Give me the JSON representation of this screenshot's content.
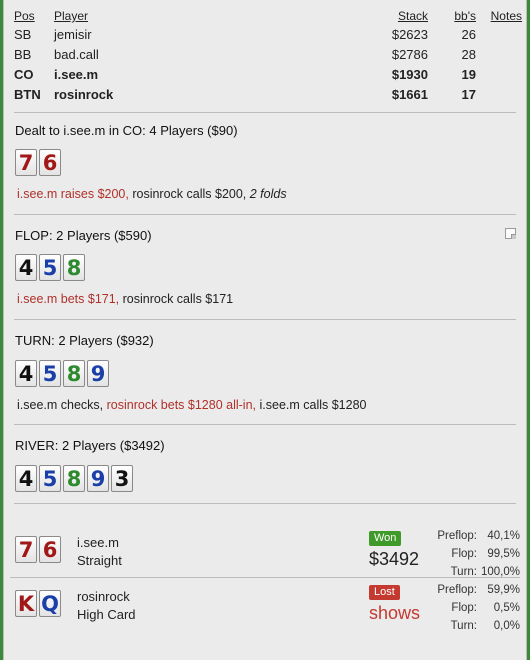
{
  "table": {
    "headers": {
      "pos": "Pos",
      "player": "Player",
      "stack": "Stack",
      "bbs": "bb's",
      "notes": "Notes"
    },
    "rows": [
      {
        "pos": "SB",
        "player": "jemisir",
        "stack": "$2623",
        "bbs": "26",
        "bold": false
      },
      {
        "pos": "BB",
        "player": "bad.call",
        "stack": "$2786",
        "bbs": "28",
        "bold": false
      },
      {
        "pos": "CO",
        "player": "i.see.m",
        "stack": "$1930",
        "bbs": "19",
        "bold": true
      },
      {
        "pos": "BTN",
        "player": "rosinrock",
        "stack": "$1661",
        "bbs": "17",
        "bold": true
      }
    ]
  },
  "preflop": {
    "title": "Dealt to i.see.m in CO: 4 Players ($90)",
    "cards": [
      {
        "rank": "7",
        "suit_color": "#a01818"
      },
      {
        "rank": "6",
        "suit_color": "#a01818"
      }
    ],
    "action_red": "i.see.m raises $200,",
    "action_plain": " rosinrock calls $200, ",
    "action_italic": "2 folds"
  },
  "flop": {
    "title": "FLOP: 2 Players ($590)",
    "cards": [
      {
        "rank": "4",
        "suit_color": "#111111"
      },
      {
        "rank": "5",
        "suit_color": "#1a3fa8"
      },
      {
        "rank": "8",
        "suit_color": "#2e8a2e"
      }
    ],
    "action_red": "i.see.m bets $171,",
    "action_plain": " rosinrock calls $171",
    "note_icon": "note-icon"
  },
  "turn": {
    "title": "TURN: 2 Players ($932)",
    "cards": [
      {
        "rank": "4",
        "suit_color": "#111111"
      },
      {
        "rank": "5",
        "suit_color": "#1a3fa8"
      },
      {
        "rank": "8",
        "suit_color": "#2e8a2e"
      },
      {
        "rank": "9",
        "suit_color": "#1a3fa8"
      }
    ],
    "action_pre": "i.see.m checks, ",
    "action_red": "rosinrock bets $1280 all-in,",
    "action_post": " i.see.m calls $1280"
  },
  "river": {
    "title": "RIVER: 2 Players ($3492)",
    "cards": [
      {
        "rank": "4",
        "suit_color": "#111111"
      },
      {
        "rank": "5",
        "suit_color": "#1a3fa8"
      },
      {
        "rank": "8",
        "suit_color": "#2e8a2e"
      },
      {
        "rank": "9",
        "suit_color": "#1a3fa8"
      },
      {
        "rank": "3",
        "suit_color": "#111111"
      }
    ]
  },
  "results": [
    {
      "cards": [
        {
          "rank": "7",
          "suit_color": "#a01818"
        },
        {
          "rank": "6",
          "suit_color": "#a01818"
        }
      ],
      "player": "i.see.m",
      "hand": "Straight",
      "badge": "Won",
      "badge_type": "won",
      "amount": "$3492",
      "amount_color": "#222222",
      "stats": [
        {
          "label": "Preflop:",
          "value": "40,1%"
        },
        {
          "label": "Flop:",
          "value": "99,5%"
        },
        {
          "label": "Turn:",
          "value": "100,0%"
        }
      ]
    },
    {
      "cards": [
        {
          "rank": "K",
          "suit_color": "#a01818"
        },
        {
          "rank": "Q",
          "suit_color": "#1a3fa8"
        }
      ],
      "player": "rosinrock",
      "hand": "High Card",
      "badge": "Lost",
      "badge_type": "lost",
      "amount": "shows",
      "amount_color": "#c43a31",
      "stats": [
        {
          "label": "Preflop:",
          "value": "59,9%"
        },
        {
          "label": "Flop:",
          "value": "0,5%"
        },
        {
          "label": "Turn:",
          "value": "0,0%"
        }
      ]
    }
  ]
}
